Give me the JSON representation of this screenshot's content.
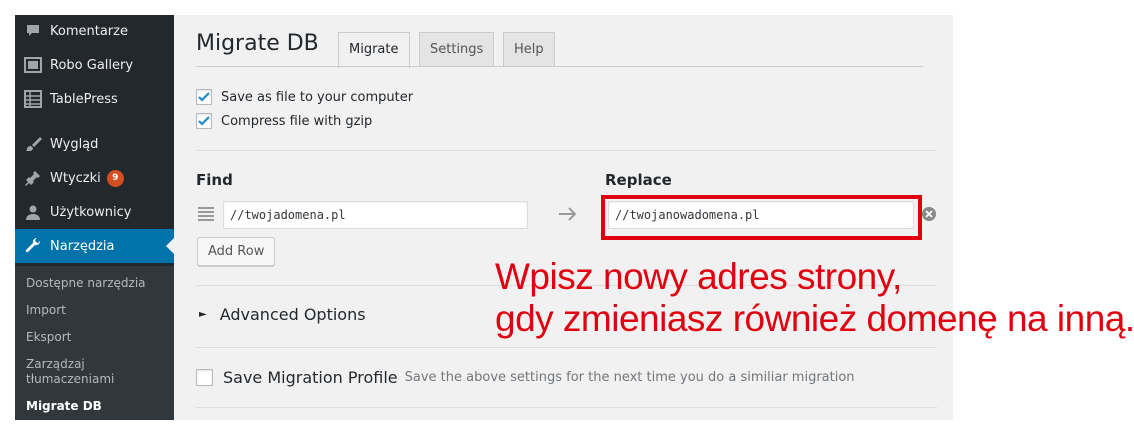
{
  "sidebar": {
    "items": [
      {
        "label": "Komentarze",
        "icon": "comment-icon"
      },
      {
        "label": "Robo Gallery",
        "icon": "gallery-icon"
      },
      {
        "label": "TablePress",
        "icon": "table-icon"
      },
      {
        "label": "Wygląd",
        "icon": "paintbrush-icon"
      },
      {
        "label": "Wtyczki",
        "icon": "plugin-icon",
        "badge": "9"
      },
      {
        "label": "Użytkownicy",
        "icon": "user-icon"
      },
      {
        "label": "Narzędzia",
        "icon": "wrench-icon",
        "active": true
      }
    ],
    "submenu": [
      {
        "label": "Dostępne narzędzia"
      },
      {
        "label": "Import"
      },
      {
        "label": "Eksport"
      },
      {
        "label": "Zarządzaj tłumaczeniami"
      },
      {
        "label": "Migrate DB",
        "current": true
      }
    ]
  },
  "main": {
    "title": "Migrate DB",
    "tabs": [
      {
        "label": "Migrate",
        "active": true
      },
      {
        "label": "Settings"
      },
      {
        "label": "Help"
      }
    ],
    "options": [
      {
        "label": "Save as file to your computer",
        "checked": true
      },
      {
        "label": "Compress file with gzip",
        "checked": true
      }
    ],
    "find_label": "Find",
    "replace_label": "Replace",
    "find_value": "//twojadomena.pl",
    "replace_value": "//twojanowadomena.pl",
    "add_row_label": "Add Row",
    "advanced_label": "Advanced Options",
    "profile_label": "Save Migration Profile",
    "profile_desc": "Save the above settings for the next time you do a similiar migration"
  },
  "annotation": {
    "line1": "Wpisz nowy adres strony,",
    "line2": "gdy zmieniasz również domenę na inną."
  },
  "colors": {
    "sidebar_bg": "#23282d",
    "active_bg": "#0073aa",
    "checkmark": "#1e8cbe",
    "highlight": "#e1000f",
    "badge": "#d54e21"
  }
}
